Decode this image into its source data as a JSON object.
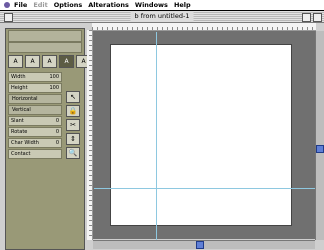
{
  "menubar": {
    "items": [
      "File",
      "Edit",
      "Options",
      "Alterations",
      "Windows",
      "Help"
    ]
  },
  "window": {
    "title": "b from untitled-1"
  },
  "toolbox": {
    "tools": [
      "A",
      "A",
      "A",
      "A",
      "A"
    ],
    "properties": [
      {
        "label": "Width",
        "value": "100"
      },
      {
        "label": "Height",
        "value": "100"
      },
      {
        "label": "Horizontal",
        "value": ""
      },
      {
        "label": "Vertical",
        "value": ""
      },
      {
        "label": "Slant",
        "value": "0"
      },
      {
        "label": "Rotate",
        "value": "0"
      },
      {
        "label": "Char Width",
        "value": "0"
      },
      {
        "label": "Contact",
        "value": ""
      }
    ],
    "side_tools": [
      "↖",
      "🔒",
      "✂",
      "⇕",
      "🔍"
    ]
  },
  "colors": {
    "panel": "#999977",
    "canvas": "#707070",
    "guide": "#8ec8e0",
    "scroll_thumb": "#5f7fd6"
  }
}
